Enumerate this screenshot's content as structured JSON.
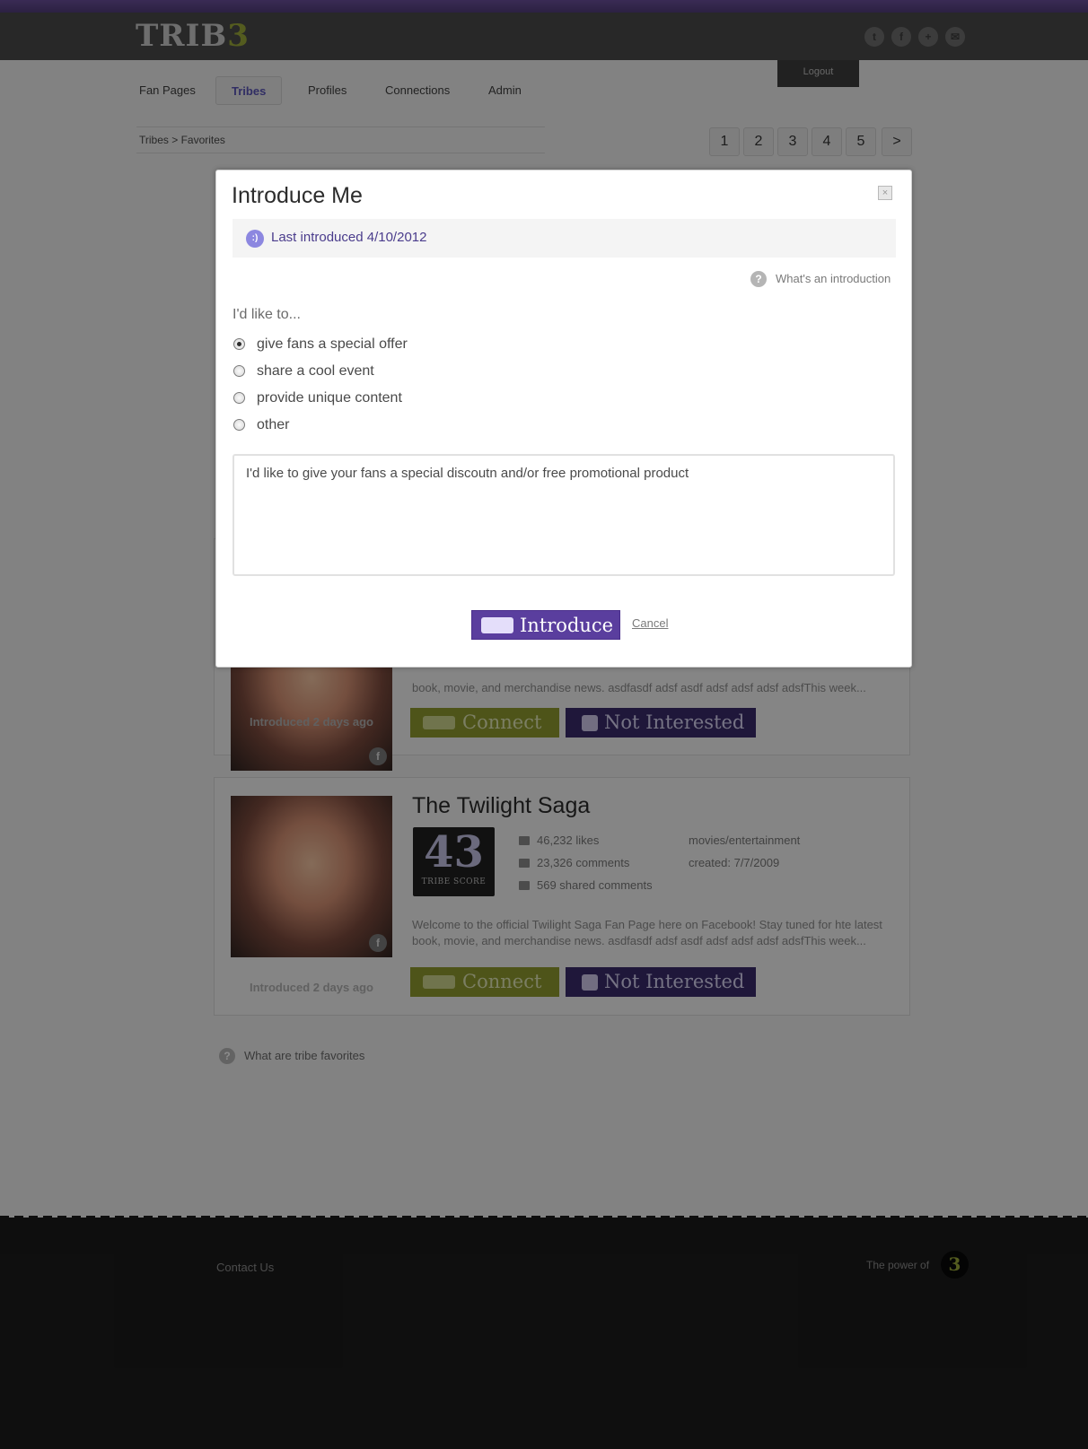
{
  "header": {
    "logo_main": "TRIB",
    "logo_accent": "3",
    "social": [
      {
        "icon": "twitter-icon",
        "glyph": "t"
      },
      {
        "icon": "facebook-icon",
        "glyph": "f"
      },
      {
        "icon": "google-icon",
        "glyph": "+"
      },
      {
        "icon": "email-icon",
        "glyph": "✉"
      }
    ],
    "logout": "Logout"
  },
  "nav": {
    "items": [
      {
        "label": "Fan Pages",
        "active": false
      },
      {
        "label": "Tribes",
        "active": true
      },
      {
        "label": "Profiles",
        "active": false
      },
      {
        "label": "Connections",
        "active": false
      },
      {
        "label": "Admin",
        "active": false
      }
    ]
  },
  "breadcrumb": "Tribes > Favorites",
  "pagination": [
    "1",
    "2",
    "3",
    "4",
    "5",
    ">"
  ],
  "cards": [
    {
      "title": "The Twilight Saga",
      "score": "43",
      "score_label": "TRIBE SCORE",
      "likes": "46,232 likes",
      "comments": "23,326 comments",
      "shared": "569 shared comments",
      "category": "movies/entertainment",
      "created": "created: 7/7/2009",
      "description": "Welcome to the official Twilight Saga Fan Page here on Facebook! Stay tuned for hte latest book, movie, and merchandise news. asdfasdf adsf asdf adsf adsf adsf adsfThis week...",
      "introduced": "Introduced 2 days ago",
      "connect": "Connect",
      "not_interested": "Not Interested"
    }
  ],
  "partial_card": {
    "description_line2": "book, movie, and merchandise news. asdfasdf adsf asdf adsf adsf adsf adsfThis week...",
    "introduced": "Introduced 2 days ago",
    "connect": "Connect",
    "not_interested": "Not Interested"
  },
  "help_bottom": "What are tribe favorites",
  "footer": {
    "contact": "Contact Us",
    "power": "The power of",
    "power_logo": "3"
  },
  "modal": {
    "title": "Introduce Me",
    "close": "×",
    "last_icon": ":)",
    "last_introduced": "Last introduced 4/10/2012",
    "help_link": "What's an introduction",
    "prompt": "I'd like to...",
    "options": [
      {
        "label": "give fans a special offer",
        "selected": true
      },
      {
        "label": "share a cool event",
        "selected": false
      },
      {
        "label": "provide unique content",
        "selected": false
      },
      {
        "label": "other",
        "selected": false
      }
    ],
    "message": "I'd like to give your fans a special discoutn and/or free promotional product",
    "submit": "Introduce",
    "cancel": "Cancel"
  },
  "colors": {
    "brand_purple": "#5a3e9e",
    "brand_green": "#9aa83a",
    "header_dark": "#4a4a4a"
  }
}
